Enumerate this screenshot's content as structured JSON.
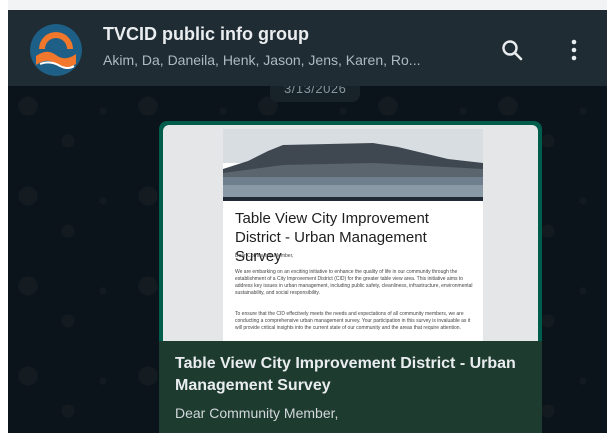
{
  "header": {
    "title": "TVCID public info group",
    "subtitle": "Akim, Da, Daneila, Henk, Jason, Jens, Karen, Ro..."
  },
  "chat": {
    "date_label": "3/13/2026"
  },
  "message": {
    "preview": {
      "doc_title": "Table View City Improvement District - Urban Management Survey",
      "greeting": "Dear Community Member,",
      "para1": "We are embarking on an exciting initiative to enhance the quality of life in our community through the establishment of a City Improvement District (CID) for the greater table view area. This initiative aims to address key issues in urban management, including public safety, cleanliness, infrastructure, environmental sustainability, and social responsibility.",
      "para2": "To ensure that the CID effectively meets the needs and expectations of all community members, we are conducting a comprehensive urban management survey. Your participation in this survey is invaluable as it will provide critical insights into the current state of our community and the areas that require attention."
    },
    "link_title": "Table View City Improvement District - Urban Management Survey",
    "link_description": "Dear Community Member,"
  },
  "icons": {
    "search": "search-icon",
    "menu": "more-vertical-icon"
  },
  "colors": {
    "header_bg": "#202c33",
    "chat_bg": "#0b141a",
    "bubble_bg": "#005c4b",
    "link_bg": "#1e3b2f"
  }
}
